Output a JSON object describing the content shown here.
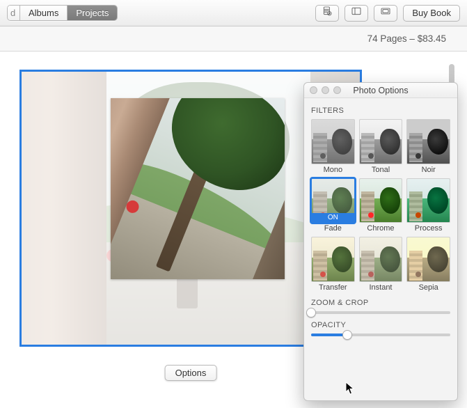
{
  "toolbar": {
    "tabs": [
      "Albums",
      "Projects"
    ],
    "active_tab_index": 1,
    "buy_label": "Buy Book"
  },
  "infobar": {
    "text": "74 Pages – $83.45"
  },
  "options_button": {
    "label": "Options"
  },
  "panel": {
    "title": "Photo Options",
    "sections": {
      "filters_label": "FILTERS",
      "zoom_label": "ZOOM & CROP",
      "opacity_label": "OPACITY"
    },
    "filters": [
      {
        "name": "Mono",
        "key": "mono",
        "selected": false
      },
      {
        "name": "Tonal",
        "key": "tonal",
        "selected": false
      },
      {
        "name": "Noir",
        "key": "noir",
        "selected": false
      },
      {
        "name": "Fade",
        "key": "fade",
        "selected": true,
        "badge": "ON"
      },
      {
        "name": "Chrome",
        "key": "chrome",
        "selected": false
      },
      {
        "name": "Process",
        "key": "process",
        "selected": false
      },
      {
        "name": "Transfer",
        "key": "transfer",
        "selected": false
      },
      {
        "name": "Instant",
        "key": "instant",
        "selected": false
      },
      {
        "name": "Sepia",
        "key": "sepia",
        "selected": false
      }
    ],
    "zoom_value_pct": 0,
    "opacity_value_pct": 26
  }
}
